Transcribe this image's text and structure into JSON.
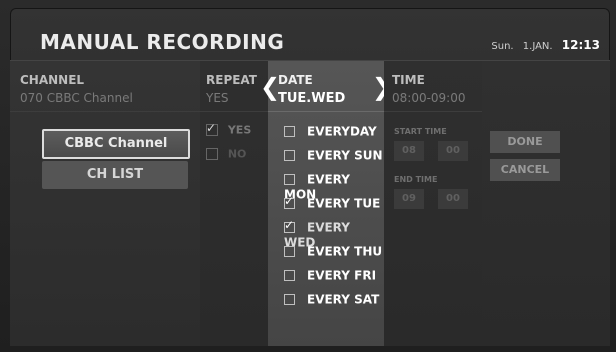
{
  "header": {
    "title": "MANUAL RECORDING",
    "day": "Sun.",
    "date": "1.JAN.",
    "time": "12:13"
  },
  "channel": {
    "label": "CHANNEL",
    "value": "070 CBBC Channel",
    "selected_button": "CBBC Channel",
    "list_button": "CH LIST"
  },
  "repeat": {
    "label": "REPEAT",
    "value": "YES",
    "options": [
      {
        "label": "YES",
        "checked": true
      },
      {
        "label": "NO",
        "checked": false
      }
    ]
  },
  "date": {
    "label": "DATE",
    "value": "TUE.WED",
    "options": [
      {
        "label": "EVERYDAY",
        "checked": false
      },
      {
        "label": "EVERY SUN",
        "checked": false
      },
      {
        "label": "EVERY MON",
        "checked": false
      },
      {
        "label": "EVERY TUE",
        "checked": true
      },
      {
        "label": "EVERY WED",
        "checked": true
      },
      {
        "label": "EVERY THU",
        "checked": false
      },
      {
        "label": "EVERY FRI",
        "checked": false
      },
      {
        "label": "EVERY SAT",
        "checked": false
      }
    ]
  },
  "time": {
    "label": "TIME",
    "value": "08:00-09:00",
    "start_label": "START TIME",
    "start_hour": "08",
    "start_min": "00",
    "end_label": "END TIME",
    "end_hour": "09",
    "end_min": "00"
  },
  "actions": {
    "done": "DONE",
    "cancel": "CANCEL"
  }
}
